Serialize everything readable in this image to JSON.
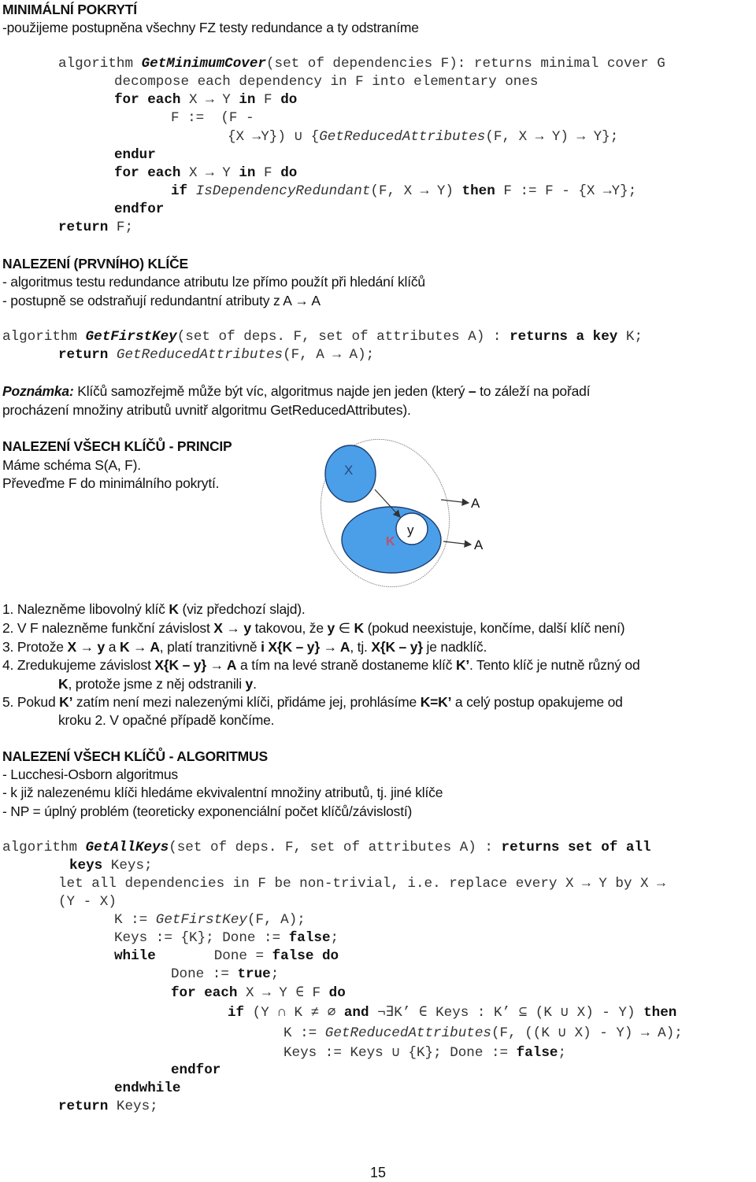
{
  "section1": {
    "title": "MINIMÁLNÍ POKRYTÍ",
    "subtitle": "-použijeme postupněna všechny FZ testy redundance a ty odstraníme",
    "algo": {
      "l1_kw": "algorithm ",
      "l1_fn": "GetMinimumCover",
      "l1_rest": "(set of dependencies F): returns minimal cover G",
      "l2": "decompose each dependency in F into elementary ones",
      "l3_kw1": "for each",
      "l3_mid": " X → Y ",
      "l3_kw2": "in",
      "l3_f": " F ",
      "l3_kw3": "do",
      "l4": "F :=  (F -",
      "l5_a": "{X →Y}) ∪ {",
      "l5_fn": "GetReducedAttributes",
      "l5_b": "(F, X → Y) → Y};",
      "l6": "endur",
      "l7_kw1": "for each",
      "l7_mid": " X → Y ",
      "l7_kw2": "in",
      "l7_f": " F ",
      "l7_kw3": "do",
      "l8_kw": "if",
      "l8_fn": " IsDependencyRedundant",
      "l8_a": "(F, X → Y) ",
      "l8_kw2": "then",
      "l8_b": " F := F - {X →Y};",
      "l9": "endfor",
      "l10_kw": "return",
      "l10_rest": " F;"
    }
  },
  "section2": {
    "title": "NALEZENÍ (PRVNÍHO) KLÍČE",
    "bullets": [
      "- algoritmus testu redundance atributu lze přímo použít při hledání klíčů",
      "- postupně se odstraňují redundantní atributy z A → A"
    ],
    "algo": {
      "l1_kw": "algorithm ",
      "l1_fn": "GetFirstKey",
      "l1_a": "(set of deps. F, set of attributes A) : ",
      "l1_kw2": "returns a key",
      "l1_b": " K;",
      "l2_kw": "return",
      "l2_fn": " GetReducedAttributes",
      "l2_b": "(F, A → A);"
    }
  },
  "note": {
    "label": "Poznámka:",
    "text1": " Klíčů samozřejmě může být víc, algoritmus najde jen jeden (který ",
    "dash": "–",
    "text2": " to záleží na pořadí",
    "line2": "procházení množiny atributů uvnitř algoritmu GetReducedAttributes)."
  },
  "section3": {
    "title": "NALEZENÍ VŠECH KLÍČŮ - PRINCIP",
    "lines": [
      "Máme schéma S(A, F).",
      "Převeďme F do minimálního pokrytí."
    ],
    "diagram": {
      "label_x": "X",
      "label_k": "K",
      "label_y": "y",
      "label_a1": "A",
      "label_a2": "A",
      "fill_color": "#4a9fe8",
      "k_color": "#c0506a"
    },
    "steps": [
      {
        "n": "1.",
        "parts": [
          " Nalezněme libovolný klíč ",
          {
            "b": "K"
          },
          " (viz předchozí slajd)."
        ]
      },
      {
        "n": "2.",
        "parts": [
          " V F nalezněme funkční závislost ",
          {
            "b": "X → y"
          },
          " takovou, že ",
          {
            "b": "y"
          },
          " ∈ ",
          {
            "b": "K"
          },
          " (pokud neexistuje, končíme, další klíč není)"
        ]
      },
      {
        "n": "3.",
        "parts": [
          " Protože ",
          {
            "b": "X → y"
          },
          " a ",
          {
            "b": "K → A"
          },
          ", platí tranzitivně ",
          {
            "b": "i X{K – y} → A"
          },
          ", tj. ",
          {
            "b": "X{K – y}"
          },
          " je nadklíč."
        ]
      },
      {
        "n": "4.",
        "parts": [
          " Zredukujeme závislost ",
          {
            "b": "X{K – y} → A"
          },
          " a tím na levé straně dostaneme klíč ",
          {
            "b": "K’"
          },
          ". Tento klíč je nutně různý od"
        ]
      },
      {
        "n": "",
        "cont": true,
        "parts": [
          {
            "b": "K"
          },
          ", protože jsme z něj odstranili ",
          {
            "b": "y"
          },
          "."
        ]
      },
      {
        "n": "5.",
        "parts": [
          " Pokud ",
          {
            "b": "K’"
          },
          " zatím není mezi nalezenými klíči, přidáme jej, prohlásíme ",
          {
            "b": "K=K’"
          },
          " a celý postup opakujeme od"
        ]
      },
      {
        "n": "",
        "cont": true,
        "parts": [
          "kroku 2. V opačné případě končíme."
        ]
      }
    ]
  },
  "section4": {
    "title": "NALEZENÍ VŠECH KLÍČŮ - ALGORITMUS",
    "bullets": [
      "- Lucchesi-Osborn algoritmus",
      "- k již nalezenému klíči hledáme ekvivalentní množiny atributů, tj. jiné klíče",
      "- NP = úplný problém (teoreticky exponenciální počet klíčů/závislostí)"
    ],
    "algo": {
      "l1_kw": "algorithm ",
      "l1_fn": "GetAllKeys",
      "l1_a": "(set of deps. F, set of attributes A) : ",
      "l1_kw2": "returns set of all",
      "l2_kw": "keys",
      "l2_b": " Keys;",
      "l3": "let all dependencies in F be non-trivial, i.e. replace every X → Y by X →",
      "l4": "(Y - X)",
      "l5_a": "K := ",
      "l5_fn": "GetFirstKey",
      "l5_b": "(F, A);",
      "l6_a": "Keys := {K}; Done := ",
      "l6_kw": "false",
      "l6_b": ";",
      "l7_kw": "while",
      "l7_a": "       Done = ",
      "l7_kw2": "false do",
      "l8_a": "Done := ",
      "l8_kw": "true",
      "l8_b": ";",
      "l9_kw": "for each",
      "l9_a": " X → Y ∈ F ",
      "l9_kw2": "do",
      "l10_kw": "if",
      "l10_a": " (Y ∩ K ≠ ∅ ",
      "l10_kw2": "and",
      "l10_b": " ¬∃K’ ∈ Keys : K’ ⊆ (K ∪ X) - Y) ",
      "l10_kw3": "then",
      "l11_a": "K := ",
      "l11_fn": "GetReducedAttributes",
      "l11_b": "(F, ((K ∪ X) - Y) → A);",
      "l12_a": "Keys := Keys ∪ {K}; Done := ",
      "l12_kw": "false",
      "l12_b": ";",
      "l13": "endfor",
      "l14": "endwhile",
      "l15_kw": "return",
      "l15_b": " Keys;"
    }
  },
  "page_number": "15"
}
